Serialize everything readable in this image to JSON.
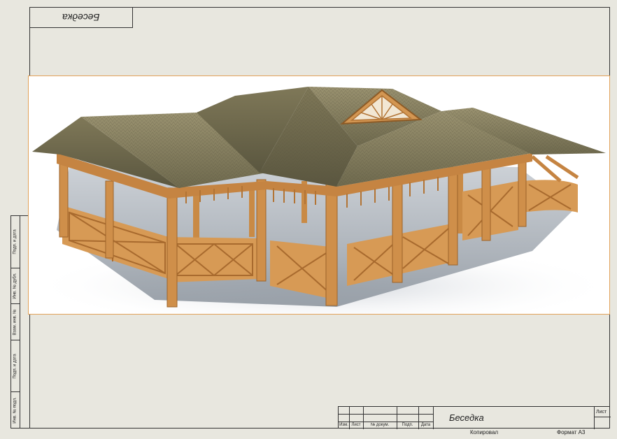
{
  "corner_stamp": "Беседка",
  "left_strip": [
    "Подп. и дата",
    "Инв. № дубл.",
    "Взам. инв. №",
    "Подп. и дата",
    "Инв. № подл."
  ],
  "title_block": {
    "columns": [
      "Изм.",
      "Лист",
      "№ докум.",
      "Подп.",
      "Дата"
    ],
    "title": "Беседка",
    "sheet_label": "Лист"
  },
  "footer": {
    "checked": "Копировал",
    "format": "Формат A3"
  }
}
